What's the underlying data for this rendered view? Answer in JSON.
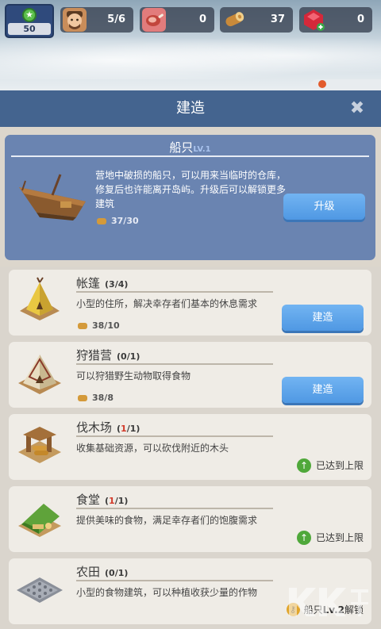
{
  "resources": {
    "level": "50",
    "survivors": "5/6",
    "meat": "0",
    "wood": "37",
    "gems": "0"
  },
  "header": {
    "title": "建造",
    "close_symbol": "✖"
  },
  "boat": {
    "name": "船只",
    "level": "LV.1",
    "description": "营地中破损的船只，可以用来当临时的仓库，修复后也许能离开岛屿。升级后可以解锁更多建筑",
    "cost": "37/30",
    "upgrade_label": "升级"
  },
  "buildings": [
    {
      "name": "帐篷",
      "count": "(3/4)",
      "description": "小型的住所，解决幸存者们基本的休息需求",
      "cost": "38/10",
      "action_label": "建造"
    },
    {
      "name": "狩猎营",
      "count": "(0/1)",
      "description": "可以狩猎野生动物取得食物",
      "cost": "38/8",
      "action_label": "建造"
    },
    {
      "name": "伐木场",
      "count_open": "(",
      "count_cur": "1",
      "count_rest": "/1)",
      "description": "收集基础资源，可以砍伐附近的木头",
      "status": "已达到上限"
    },
    {
      "name": "食堂",
      "count_open": "(",
      "count_cur": "1",
      "count_rest": "/1)",
      "description": "提供美味的食物，满足幸存者们的饱腹需求",
      "status": "已达到上限"
    },
    {
      "name": "农田",
      "count": "(0/1)",
      "description": "小型的食物建筑，可以种植收获少量的作物",
      "lock_prefix": "船只",
      "lock_level": "Lv.2",
      "lock_suffix": "解锁"
    }
  ],
  "icons": {
    "level": "star-icon",
    "survivors": "survivor-face-icon",
    "meat": "meat-icon",
    "wood": "wood-log-icon",
    "gems": "red-gem-icon",
    "up": "arrow-up-icon",
    "key": "key-icon"
  },
  "colors": {
    "header": "#44648f",
    "boat_card": "#6a84b1",
    "button": "#5aa3ea",
    "maxed_green": "#4fa83a",
    "count_red": "#d23a2a"
  }
}
